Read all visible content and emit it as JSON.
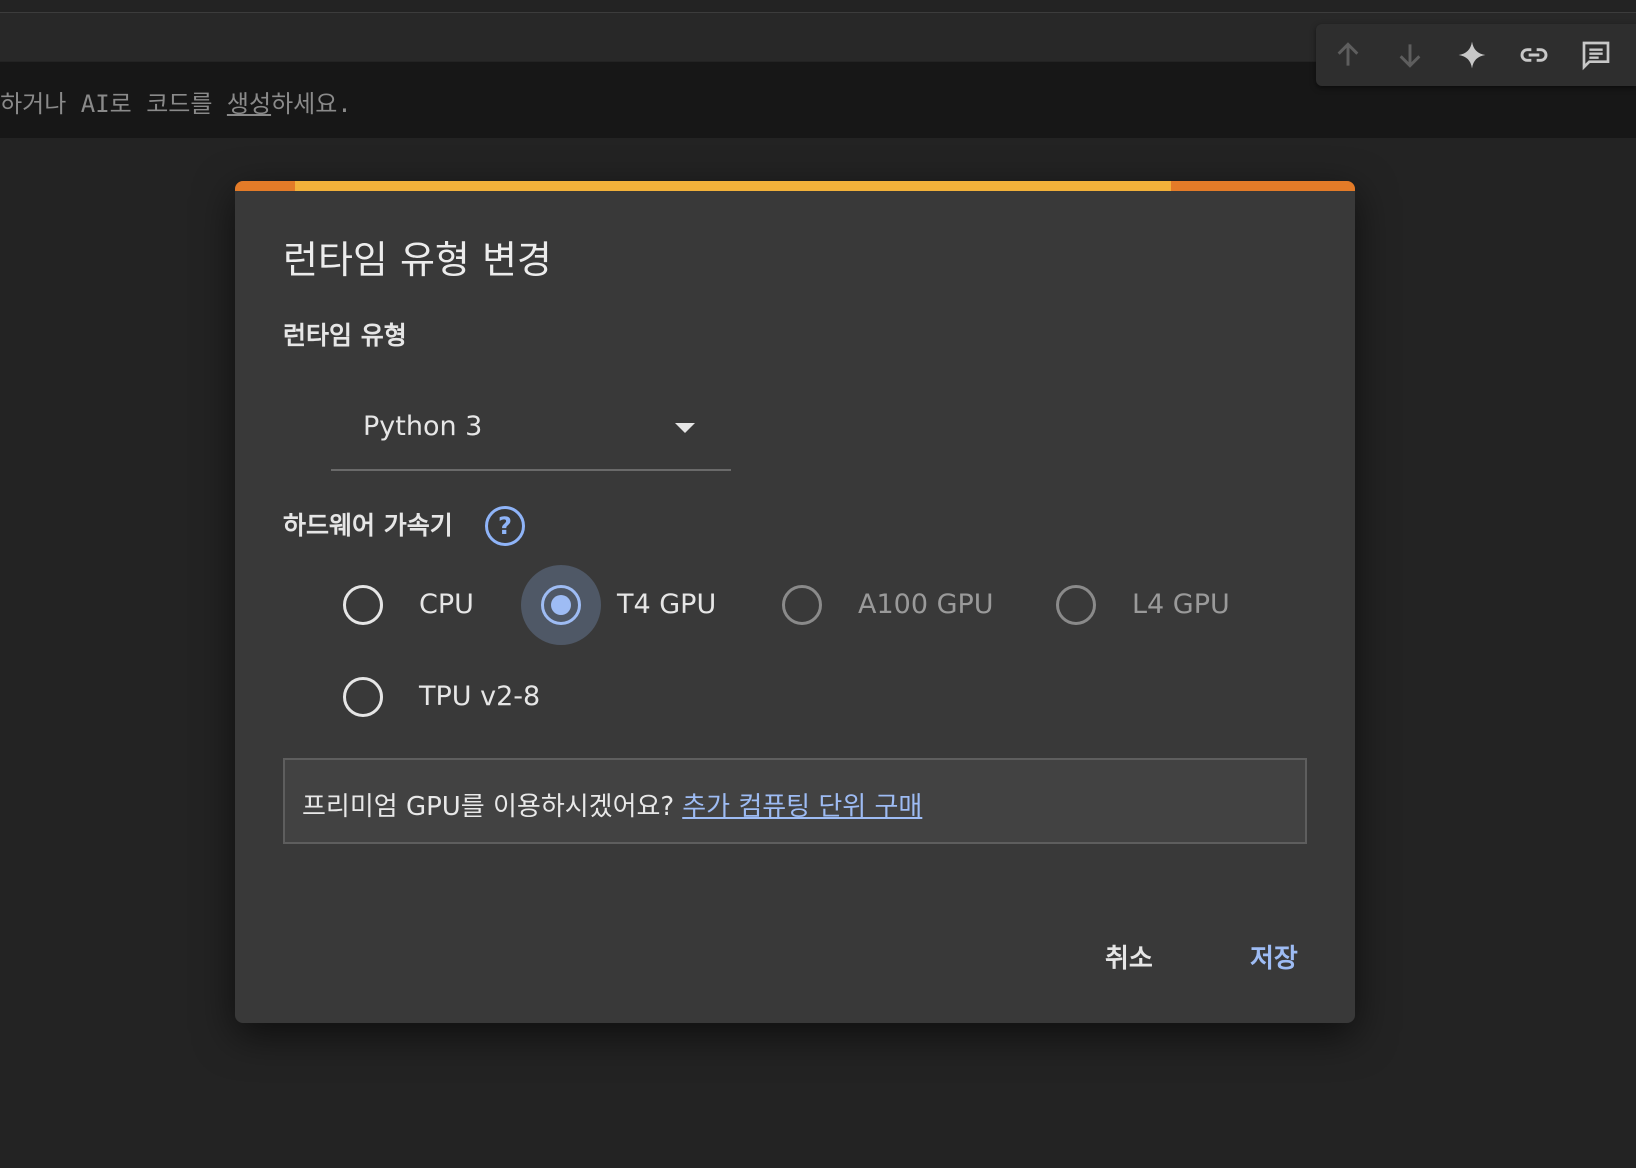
{
  "code_cell": {
    "placeholder_prefix": "탁하거나 AI로 코드를 ",
    "placeholder_link": "생성",
    "placeholder_suffix": "하세요."
  },
  "cell_toolbar": {
    "icons": [
      "arrow-up-icon",
      "arrow-down-icon",
      "sparkle-icon",
      "link-icon",
      "comment-icon"
    ]
  },
  "dialog": {
    "title": "런타임 유형 변경",
    "runtime_label": "런타임 유형",
    "runtime_value": "Python 3",
    "hardware_label": "하드웨어 가속기",
    "help_glyph": "?",
    "accelerators": [
      {
        "label": "CPU",
        "selected": false,
        "disabled": false
      },
      {
        "label": "T4 GPU",
        "selected": true,
        "disabled": false
      },
      {
        "label": "A100 GPU",
        "selected": false,
        "disabled": true
      },
      {
        "label": "L4 GPU",
        "selected": false,
        "disabled": true
      },
      {
        "label": "TPU v2-8",
        "selected": false,
        "disabled": false
      }
    ],
    "premium_text": "프리미엄 GPU를 이용하시겠어요?",
    "premium_link": "추가 컴퓨팅 단위 구매",
    "cancel_label": "취소",
    "save_label": "저장"
  },
  "colors": {
    "accent": "#9ebcf4",
    "progress_outer": "#e37b28",
    "progress_inner": "#f2b13a",
    "dialog_bg": "#393939"
  }
}
